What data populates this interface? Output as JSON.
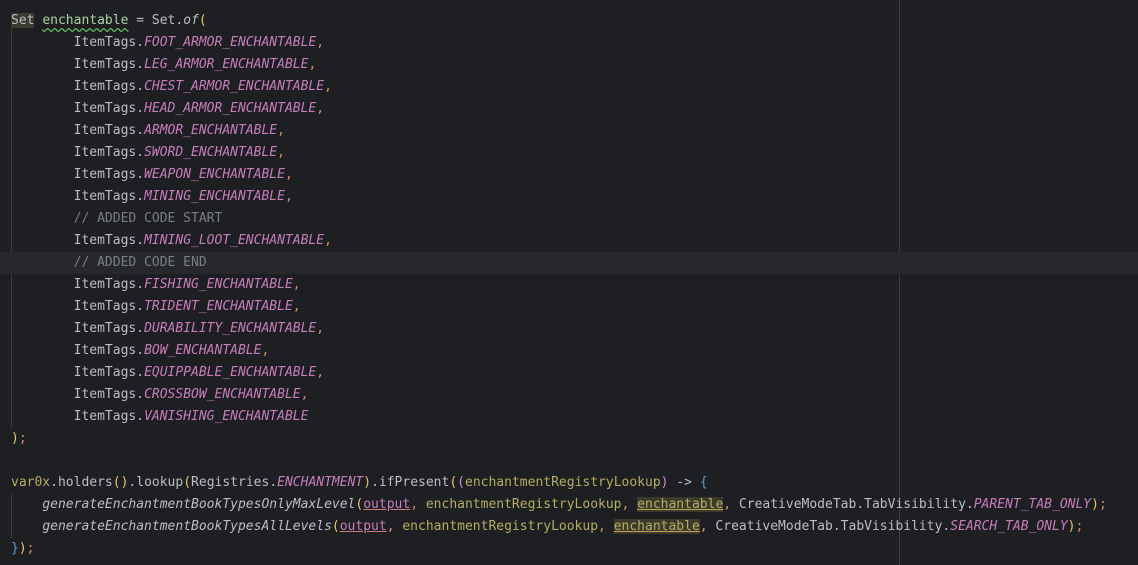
{
  "editor": {
    "lines": [
      {
        "segments": [
          {
            "c": "type-hl",
            "t": "Set"
          },
          {
            "c": "ident",
            "t": " "
          },
          {
            "c": "green-underline",
            "t": "enchantable"
          },
          {
            "c": "ident",
            "t": " = Set."
          },
          {
            "c": "method-static",
            "t": "of"
          },
          {
            "c": "bracket-yellow",
            "t": "("
          }
        ]
      },
      {
        "segments": [
          {
            "c": "ident",
            "t": "        ItemTags."
          },
          {
            "c": "field",
            "t": "FOOT_ARMOR_ENCHANTABLE"
          },
          {
            "c": "comma",
            "t": ","
          }
        ]
      },
      {
        "segments": [
          {
            "c": "ident",
            "t": "        ItemTags."
          },
          {
            "c": "field",
            "t": "LEG_ARMOR_ENCHANTABLE"
          },
          {
            "c": "comma",
            "t": ","
          }
        ]
      },
      {
        "segments": [
          {
            "c": "ident",
            "t": "        ItemTags."
          },
          {
            "c": "field",
            "t": "CHEST_ARMOR_ENCHANTABLE"
          },
          {
            "c": "comma",
            "t": ","
          }
        ]
      },
      {
        "segments": [
          {
            "c": "ident",
            "t": "        ItemTags."
          },
          {
            "c": "field",
            "t": "HEAD_ARMOR_ENCHANTABLE"
          },
          {
            "c": "comma",
            "t": ","
          }
        ]
      },
      {
        "segments": [
          {
            "c": "ident",
            "t": "        ItemTags."
          },
          {
            "c": "field",
            "t": "ARMOR_ENCHANTABLE"
          },
          {
            "c": "comma",
            "t": ","
          }
        ]
      },
      {
        "segments": [
          {
            "c": "ident",
            "t": "        ItemTags."
          },
          {
            "c": "field",
            "t": "SWORD_ENCHANTABLE"
          },
          {
            "c": "comma",
            "t": ","
          }
        ]
      },
      {
        "segments": [
          {
            "c": "ident",
            "t": "        ItemTags."
          },
          {
            "c": "field",
            "t": "WEAPON_ENCHANTABLE"
          },
          {
            "c": "comma",
            "t": ","
          }
        ]
      },
      {
        "segments": [
          {
            "c": "ident",
            "t": "        ItemTags."
          },
          {
            "c": "field",
            "t": "MINING_ENCHANTABLE"
          },
          {
            "c": "comma",
            "t": ","
          }
        ]
      },
      {
        "segments": [
          {
            "c": "comment",
            "t": "        // ADDED CODE START"
          }
        ]
      },
      {
        "segments": [
          {
            "c": "ident",
            "t": "        ItemTags."
          },
          {
            "c": "field",
            "t": "MINING_LOOT_ENCHANTABLE"
          },
          {
            "c": "comma",
            "t": ","
          }
        ]
      },
      {
        "current": true,
        "segments": [
          {
            "c": "comment",
            "t": "        // ADDED CODE END"
          }
        ]
      },
      {
        "segments": [
          {
            "c": "ident",
            "t": "        ItemTags."
          },
          {
            "c": "field",
            "t": "FISHING_ENCHANTABLE"
          },
          {
            "c": "comma",
            "t": ","
          }
        ]
      },
      {
        "segments": [
          {
            "c": "ident",
            "t": "        ItemTags."
          },
          {
            "c": "field",
            "t": "TRIDENT_ENCHANTABLE"
          },
          {
            "c": "comma",
            "t": ","
          }
        ]
      },
      {
        "segments": [
          {
            "c": "ident",
            "t": "        ItemTags."
          },
          {
            "c": "field",
            "t": "DURABILITY_ENCHANTABLE"
          },
          {
            "c": "comma",
            "t": ","
          }
        ]
      },
      {
        "segments": [
          {
            "c": "ident",
            "t": "        ItemTags."
          },
          {
            "c": "field",
            "t": "BOW_ENCHANTABLE"
          },
          {
            "c": "comma",
            "t": ","
          }
        ]
      },
      {
        "segments": [
          {
            "c": "ident",
            "t": "        ItemTags."
          },
          {
            "c": "field",
            "t": "EQUIPPABLE_ENCHANTABLE"
          },
          {
            "c": "comma",
            "t": ","
          }
        ]
      },
      {
        "segments": [
          {
            "c": "ident",
            "t": "        ItemTags."
          },
          {
            "c": "field",
            "t": "CROSSBOW_ENCHANTABLE"
          },
          {
            "c": "comma",
            "t": ","
          }
        ]
      },
      {
        "segments": [
          {
            "c": "ident",
            "t": "        ItemTags."
          },
          {
            "c": "field",
            "t": "VANISHING_ENCHANTABLE"
          }
        ]
      },
      {
        "segments": [
          {
            "c": "bracket-yellow",
            "t": ")"
          },
          {
            "c": "comma",
            "t": ";"
          }
        ]
      },
      {
        "segments": [
          {
            "c": "ident",
            "t": ""
          }
        ]
      },
      {
        "segments": [
          {
            "c": "var-green",
            "t": "var0x"
          },
          {
            "c": "ident",
            "t": ".holders"
          },
          {
            "c": "bracket-yellow",
            "t": "()"
          },
          {
            "c": "ident",
            "t": ".lookup"
          },
          {
            "c": "bracket-yellow",
            "t": "("
          },
          {
            "c": "ident",
            "t": "Registries."
          },
          {
            "c": "field",
            "t": "ENCHANTMENT"
          },
          {
            "c": "bracket-yellow",
            "t": ")"
          },
          {
            "c": "ident",
            "t": ".ifPresent"
          },
          {
            "c": "bracket-yellow",
            "t": "("
          },
          {
            "c": "bracket-pink",
            "t": "("
          },
          {
            "c": "lambda-param",
            "t": "enchantmentRegistryLookup"
          },
          {
            "c": "bracket-pink",
            "t": ")"
          },
          {
            "c": "ident",
            "t": " -> "
          },
          {
            "c": "bracket-blue",
            "t": "{"
          }
        ]
      },
      {
        "segments": [
          {
            "c": "ident",
            "t": "    "
          },
          {
            "c": "method-italic",
            "t": "generateEnchantmentBookTypesOnlyMaxLevel"
          },
          {
            "c": "bracket-yellow",
            "t": "("
          },
          {
            "c": "out-param",
            "t": "output"
          },
          {
            "c": "comma",
            "t": ","
          },
          {
            "c": "ident",
            "t": " "
          },
          {
            "c": "lambda-param",
            "t": "enchantmentRegistryLookup"
          },
          {
            "c": "comma",
            "t": ","
          },
          {
            "c": "ident",
            "t": " "
          },
          {
            "c": "hl-var",
            "t": "enchantable"
          },
          {
            "c": "comma",
            "t": ","
          },
          {
            "c": "ident",
            "t": " CreativeModeTab.TabVisibility."
          },
          {
            "c": "field",
            "t": "PARENT_TAB_ONLY"
          },
          {
            "c": "bracket-yellow",
            "t": ")"
          },
          {
            "c": "comma",
            "t": ";"
          }
        ]
      },
      {
        "segments": [
          {
            "c": "ident",
            "t": "    "
          },
          {
            "c": "method-italic",
            "t": "generateEnchantmentBookTypesAllLevels"
          },
          {
            "c": "bracket-yellow",
            "t": "("
          },
          {
            "c": "out-param",
            "t": "output"
          },
          {
            "c": "comma",
            "t": ","
          },
          {
            "c": "ident",
            "t": " "
          },
          {
            "c": "lambda-param",
            "t": "enchantmentRegistryLookup"
          },
          {
            "c": "comma",
            "t": ","
          },
          {
            "c": "ident",
            "t": " "
          },
          {
            "c": "hl-var",
            "t": "enchantable"
          },
          {
            "c": "comma",
            "t": ","
          },
          {
            "c": "ident",
            "t": " CreativeModeTab.TabVisibility."
          },
          {
            "c": "field",
            "t": "SEARCH_TAB_ONLY"
          },
          {
            "c": "bracket-yellow",
            "t": ")"
          },
          {
            "c": "comma",
            "t": ";"
          }
        ]
      },
      {
        "segments": [
          {
            "c": "bracket-blue",
            "t": "}"
          },
          {
            "c": "bracket-yellow",
            "t": ")"
          },
          {
            "c": "comma",
            "t": ";"
          }
        ]
      }
    ]
  },
  "colors": {
    "background": "#1e1f22",
    "field": "#c77dbb",
    "comment": "#7a7e85",
    "comma": "#cf8e6d",
    "current_line": "#26282e"
  }
}
